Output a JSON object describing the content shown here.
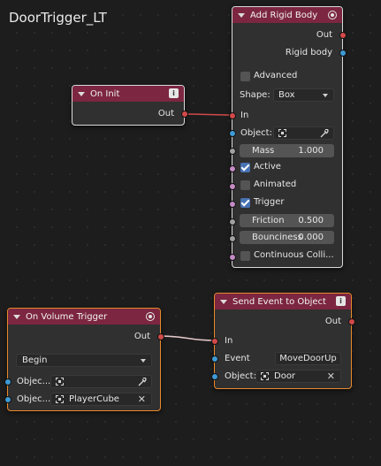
{
  "tree_title": "DoorTrigger_LT",
  "nodes": {
    "on_init": {
      "title": "On Init",
      "out": "Out"
    },
    "add_rigid_body": {
      "title": "Add Rigid Body",
      "out": "Out",
      "rigid_body": "Rigid body",
      "advanced": "Advanced",
      "shape_label": "Shape:",
      "shape_value": "Box",
      "in": "In",
      "object_label": "Object:",
      "mass_label": "Mass",
      "mass_value": "1.000",
      "active_label": "Active",
      "active_checked": true,
      "animated_label": "Animated",
      "animated_checked": false,
      "trigger_label": "Trigger",
      "trigger_checked": true,
      "friction_label": "Friction",
      "friction_value": "0.500",
      "bounciness_label": "Bounciness",
      "bounciness_value": "0.000",
      "continuous_label": "Continuous Colli..."
    },
    "on_volume_trigger": {
      "title": "On Volume Trigger",
      "out": "Out",
      "mode": "Begin",
      "object1_label": "Objec...",
      "object2_label": "Objec...",
      "object2_value": "PlayerCube"
    },
    "send_event": {
      "title": "Send Event to Object",
      "out": "Out",
      "in": "In",
      "event_label": "Event",
      "event_value": "MoveDoorUp",
      "object_label": "Object:",
      "object_value": "Door"
    }
  },
  "colors": {
    "header": "#7c2641",
    "node_bg": "#303030",
    "link": "#d24949",
    "socket_exec": "#d24949",
    "socket_object": "#3e9ad6",
    "socket_bool": "#c48bc4",
    "socket_float": "#a0a0a0",
    "selection_active": "#e88a2a",
    "checkbox_on": "#4772b3"
  },
  "icons": [
    "chevron-down-icon",
    "info-icon",
    "record-icon",
    "object-icon",
    "eyedropper-icon",
    "close-icon",
    "dropdown-arrow-icon"
  ]
}
